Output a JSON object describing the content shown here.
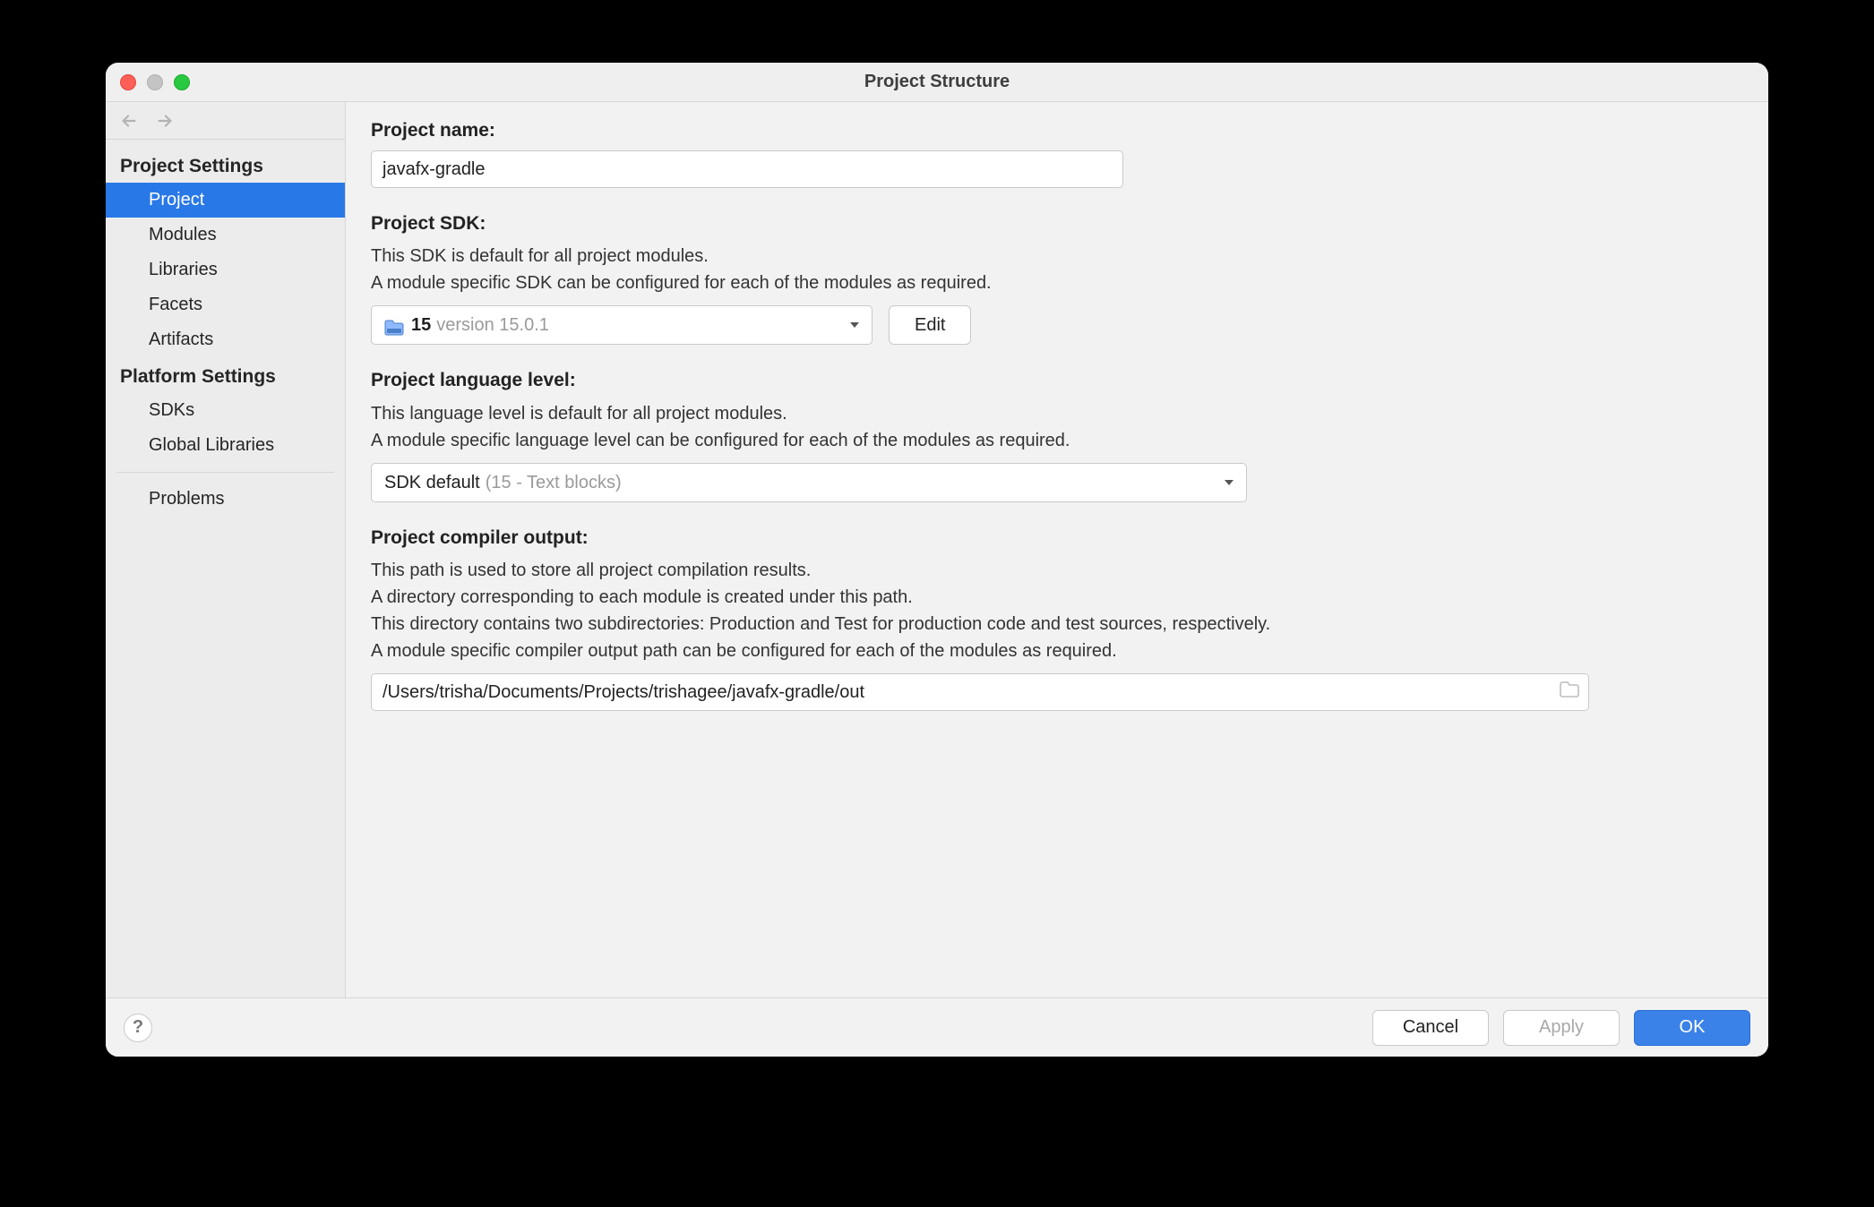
{
  "title": "Project Structure",
  "sidebar": {
    "section_project": "Project Settings",
    "items_project": [
      "Project",
      "Modules",
      "Libraries",
      "Facets",
      "Artifacts"
    ],
    "section_platform": "Platform Settings",
    "items_platform": [
      "SDKs",
      "Global Libraries"
    ],
    "problems": "Problems"
  },
  "main": {
    "project_name_label": "Project name:",
    "project_name_value": "javafx-gradle",
    "sdk_label": "Project SDK:",
    "sdk_desc_1": "This SDK is default for all project modules.",
    "sdk_desc_2": "A module specific SDK can be configured for each of the modules as required.",
    "sdk_selected_bold": "15",
    "sdk_selected_gray": "version 15.0.1",
    "edit_btn": "Edit",
    "lang_label": "Project language level:",
    "lang_desc_1": "This language level is default for all project modules.",
    "lang_desc_2": "A module specific language level can be configured for each of the modules as required.",
    "lang_selected_main": "SDK default",
    "lang_selected_gray": "(15 - Text blocks)",
    "out_label": "Project compiler output:",
    "out_desc_1": "This path is used to store all project compilation results.",
    "out_desc_2": "A directory corresponding to each module is created under this path.",
    "out_desc_3": "This directory contains two subdirectories: Production and Test for production code and test sources, respectively.",
    "out_desc_4": "A module specific compiler output path can be configured for each of the modules as required.",
    "out_value": "/Users/trisha/Documents/Projects/trishagee/javafx-gradle/out"
  },
  "footer": {
    "help": "?",
    "cancel": "Cancel",
    "apply": "Apply",
    "ok": "OK"
  }
}
